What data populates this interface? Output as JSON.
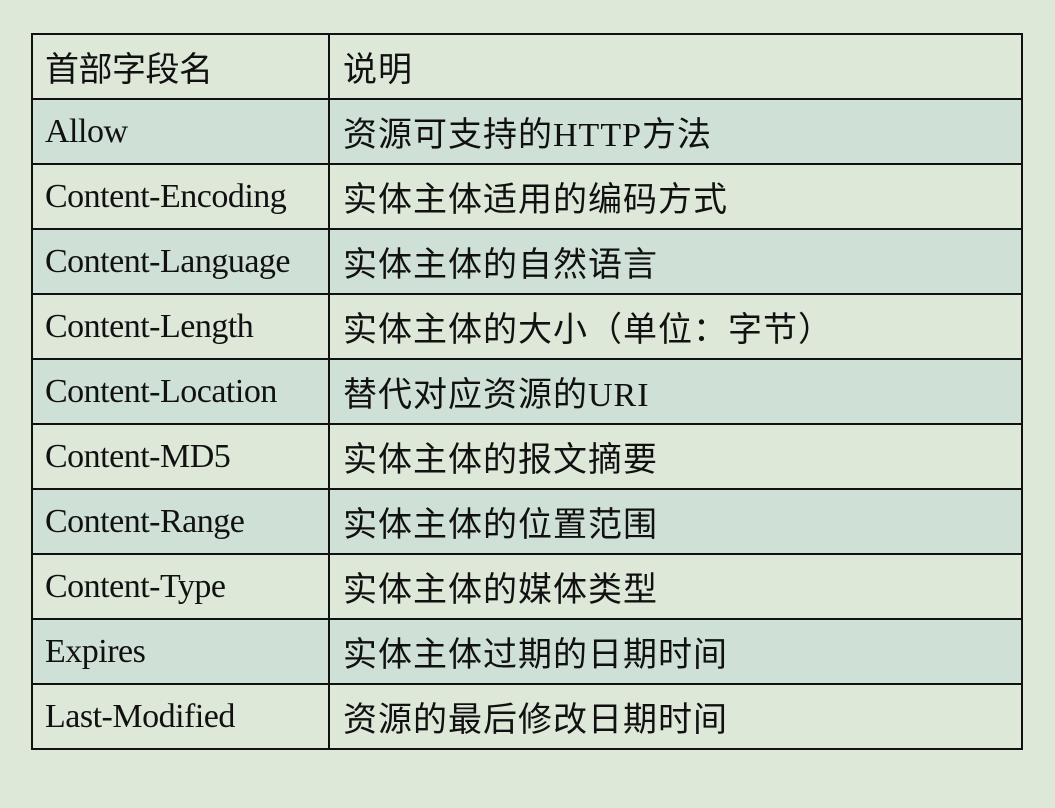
{
  "table": {
    "header": {
      "field": "首部字段名",
      "desc": "说明"
    },
    "rows": [
      {
        "field": "Allow",
        "desc": "资源可支持的HTTP方法"
      },
      {
        "field": "Content-Encoding",
        "desc": "实体主体适用的编码方式"
      },
      {
        "field": "Content-Language",
        "desc": "实体主体的自然语言"
      },
      {
        "field": "Content-Length",
        "desc": "实体主体的大小（单位：字节）"
      },
      {
        "field": "Content-Location",
        "desc": "替代对应资源的URI"
      },
      {
        "field": "Content-MD5",
        "desc": "实体主体的报文摘要"
      },
      {
        "field": "Content-Range",
        "desc": "实体主体的位置范围"
      },
      {
        "field": "Content-Type",
        "desc": "实体主体的媒体类型"
      },
      {
        "field": "Expires",
        "desc": "实体主体过期的日期时间"
      },
      {
        "field": "Last-Modified",
        "desc": "资源的最后修改日期时间"
      }
    ]
  },
  "colors": {
    "background": "#dde8d9",
    "row_alt": "#cfe0d6",
    "border": "#111111",
    "text": "#111111"
  }
}
